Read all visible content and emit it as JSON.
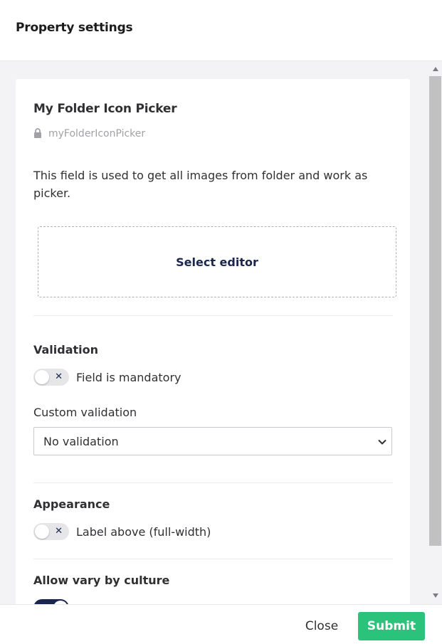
{
  "header": {
    "title": "Property settings"
  },
  "property": {
    "name": "My Folder Icon Picker",
    "alias": "myFolderIconPicker",
    "description": "This field is used to get all images from folder and work as picker."
  },
  "editor": {
    "select_label": "Select editor"
  },
  "validation": {
    "title": "Validation",
    "mandatory_label": "Field is mandatory",
    "mandatory_on": false,
    "custom_label": "Custom validation",
    "custom_value": "No validation",
    "custom_options": [
      "No validation"
    ]
  },
  "appearance": {
    "title": "Appearance",
    "label_above_label": "Label above (full-width)",
    "label_above_on": false
  },
  "culture": {
    "title": "Allow vary by culture",
    "vary_on": true
  },
  "footer": {
    "close_label": "Close",
    "submit_label": "Submit"
  },
  "colors": {
    "accent_dark": "#1b264f",
    "submit_green": "#2bc37c",
    "panel_bg": "#f3f3f5"
  },
  "icons": {
    "lock": "lock-icon",
    "toggle_off": "x-icon",
    "select": "chevron-down-icon"
  }
}
